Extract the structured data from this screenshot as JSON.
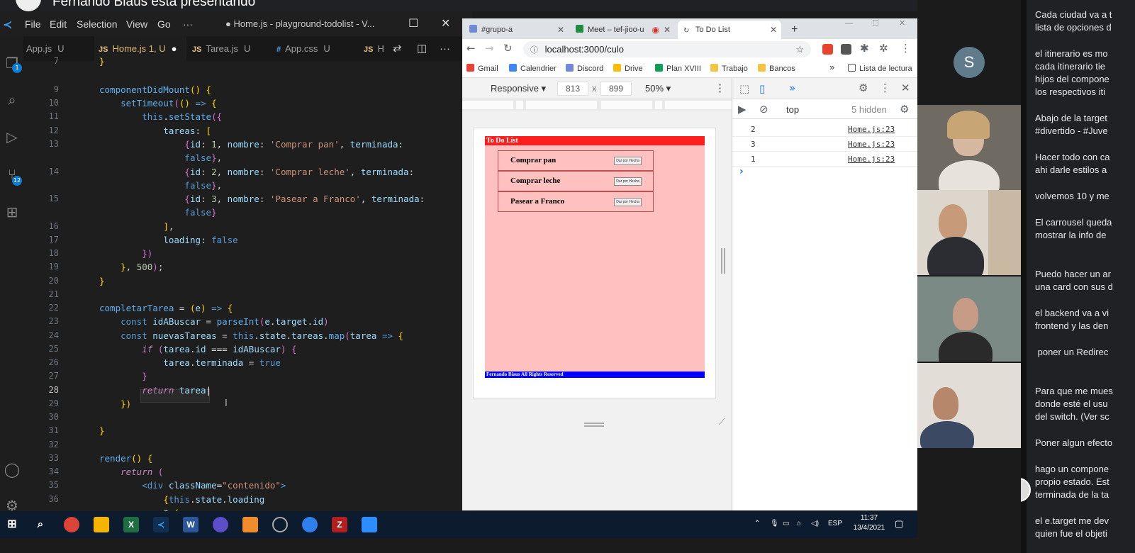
{
  "meet": {
    "presenter_banner": "Fernando Biaus está presentando"
  },
  "vscode": {
    "menu": [
      "File",
      "Edit",
      "Selection",
      "View",
      "Go",
      "···"
    ],
    "window_title": "● Home.js - playground-todolist - V...",
    "activity_badges": [
      "1",
      "12"
    ],
    "tabs": [
      {
        "icon": "JS",
        "label": "App.js",
        "status": "U",
        "active": false
      },
      {
        "icon": "JS",
        "label": "Home.js 1, U",
        "status": "●",
        "active": true
      },
      {
        "icon": "JS",
        "label": "Tarea.js",
        "status": "U",
        "active": false
      },
      {
        "icon": "#",
        "label": "App.css",
        "status": "U",
        "active": false
      },
      {
        "icon": "JS",
        "label": "H",
        "status": "",
        "active": false
      }
    ],
    "line_numbers": [
      "7",
      "9",
      "10",
      "11",
      "12",
      "13",
      "",
      "14",
      "",
      "15",
      "",
      "16",
      "17",
      "18",
      "19",
      "20",
      "21",
      "22",
      "23",
      "24",
      "25",
      "26",
      "27",
      "28",
      "29",
      "30",
      "31",
      "32",
      "33",
      "34",
      "35",
      "36"
    ],
    "current_line": "28"
  },
  "chrome": {
    "tabs": [
      {
        "label": "#grupo-a",
        "active": false
      },
      {
        "label": "Meet – tef-jioo-u",
        "active": false
      },
      {
        "label": "To Do List",
        "active": true
      }
    ],
    "new_tab": "+",
    "url": "localhost:3000/culo",
    "bookmarks": [
      "Gmail",
      "Calendrier",
      "Discord",
      "Drive",
      "Plan XVIII",
      "Trabajo",
      "Bancos",
      "»",
      "Lista de lectura"
    ],
    "device_toolbar": {
      "mode": "Responsive",
      "width": "813",
      "times": "x",
      "height": "899",
      "zoom": "50%"
    },
    "app": {
      "header": "To Do List",
      "footer": "Fernando Biaus All Rights Reserved",
      "tasks": [
        {
          "name": "Comprar pan",
          "button": "Dar por Hecha"
        },
        {
          "name": "Comprar leche",
          "button": "Dar por Hecha"
        },
        {
          "name": "Pasear a Franco",
          "button": "Dar por Hecha"
        }
      ]
    },
    "devtools": {
      "context": "top",
      "hidden_count": "5 hidden",
      "logs": [
        {
          "value": "2",
          "source": "Home.js:23"
        },
        {
          "value": "3",
          "source": "Home.js:23"
        },
        {
          "value": "1",
          "source": "Home.js:23"
        }
      ],
      "prompt": "›"
    }
  },
  "participants": {
    "avatar_letter": "S",
    "avatar_color": "#5f7b8c"
  },
  "chat": {
    "messages": [
      "Cada ciudad va a t\nlista de opciones d",
      "el itinerario es mo\ncada itinerario tie\nhijos del compone\nlos respectivos iti",
      "Abajo de la target\n#divertido - #Juve",
      "Hacer todo con ca\nahi darle estilos a",
      "volvemos 10 y me",
      "El carrousel queda\nmostrar la info de",
      "Puedo hacer un ar\nuna card con sus d",
      "el backend va a vi\nfrontend y las den",
      " poner un Redirec",
      "Para que me mues\ndonde esté el usu\ndel switch. (Ver sc",
      "Poner algun efecto",
      "hago un compone\npropio estado. Est\nterminada de la ta",
      "el e.target me dev\nquien fue el objeti"
    ]
  },
  "taskbar": {
    "language": "ESP",
    "time": "11:37",
    "date": "13/4/2021"
  }
}
